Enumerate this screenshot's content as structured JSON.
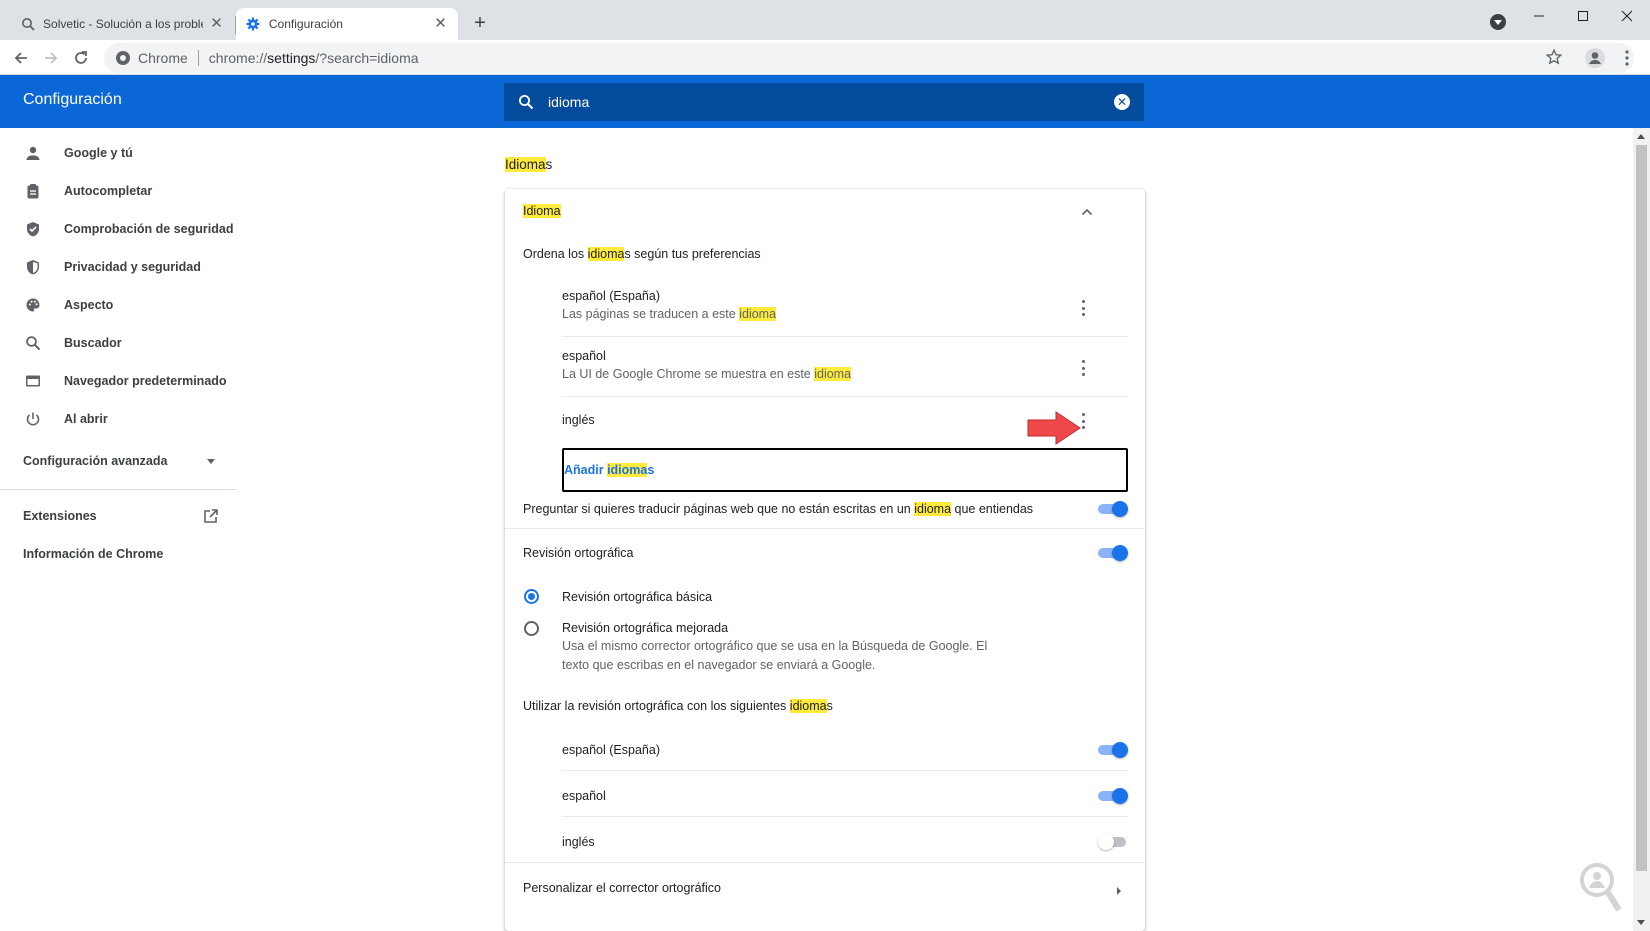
{
  "tabs": [
    {
      "title": "Solvetic - Solución a los problem",
      "active": false
    },
    {
      "title": "Configuración",
      "active": true
    }
  ],
  "omnibox": {
    "site": "Chrome",
    "url_prefix": "chrome://",
    "url_host": "settings",
    "url_rest": "/?search=idioma"
  },
  "header": {
    "title": "Configuración",
    "search_value": "idioma"
  },
  "sidebar": {
    "items": [
      {
        "label": "Google y tú",
        "icon": "person-icon"
      },
      {
        "label": "Autocompletar",
        "icon": "clipboard-icon"
      },
      {
        "label": "Comprobación de seguridad",
        "icon": "shield-check-icon"
      },
      {
        "label": "Privacidad y seguridad",
        "icon": "shield-icon"
      },
      {
        "label": "Aspecto",
        "icon": "palette-icon"
      },
      {
        "label": "Buscador",
        "icon": "search-icon"
      },
      {
        "label": "Navegador predeterminado",
        "icon": "browser-icon"
      },
      {
        "label": "Al abrir",
        "icon": "power-icon"
      }
    ],
    "advanced": "Configuración avanzada",
    "extensions": "Extensiones",
    "about": "Información de Chrome"
  },
  "main": {
    "section_title_hl": "Idioma",
    "section_title_rest": "s",
    "card_title": "Idioma",
    "order_pre": "Ordena los ",
    "order_hl": "idioma",
    "order_post": "s según tus preferencias",
    "languages": [
      {
        "name": "español (España)",
        "desc_pre": "Las páginas se traducen a este ",
        "desc_hl": "idioma"
      },
      {
        "name": "español",
        "desc_pre": "La UI de Google Chrome se muestra en este ",
        "desc_hl": "idioma"
      },
      {
        "name": "inglés",
        "desc_pre": "",
        "desc_hl": ""
      }
    ],
    "add_pre": "Añadir ",
    "add_hl": "idioma",
    "add_post": "s",
    "translate_pre": "Preguntar si quieres traducir páginas web que no están escritas en un ",
    "translate_hl": "idioma",
    "translate_post": " que entiendas",
    "translate_on": true,
    "spell_title": "Revisión ortográfica",
    "spell_on": true,
    "spell_basic": "Revisión ortográfica básica",
    "spell_enhanced": "Revisión ortográfica mejorada",
    "spell_enhanced_desc1": "Usa el mismo corrector ortográfico que se usa en la Búsqueda de Google. El",
    "spell_enhanced_desc2": "texto que escribas en el navegador se enviará a Google.",
    "spell_langs_pre": "Utilizar la revisión ortográfica con los siguientes ",
    "spell_langs_hl": "idioma",
    "spell_langs_post": "s",
    "spell_languages": [
      {
        "name": "español (España)",
        "on": true
      },
      {
        "name": "español",
        "on": true
      },
      {
        "name": "inglés",
        "on": false
      }
    ],
    "customize": "Personalizar el corrector ortográfico"
  },
  "colors": {
    "header": "#0b66d6",
    "accent": "#1a73e8",
    "highlight": "#ffeb3b",
    "arrow": "#f0484a"
  }
}
